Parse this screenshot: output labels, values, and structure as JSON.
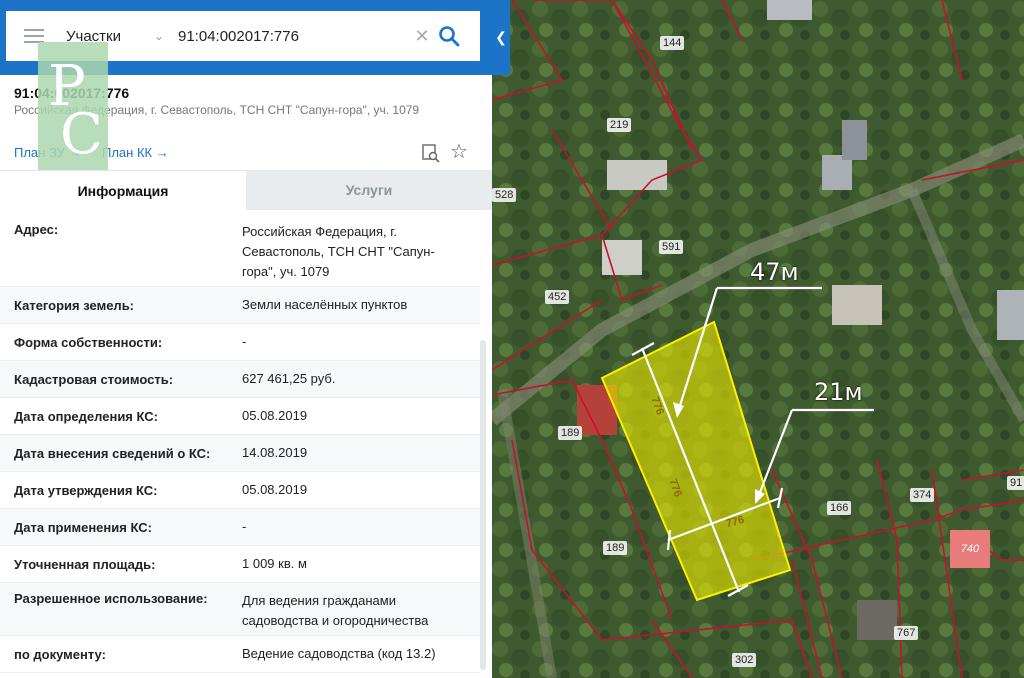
{
  "search": {
    "layer": "Участки",
    "value": "91:04:002017:776"
  },
  "object": {
    "cadastral_number": "91:04:002017:776",
    "address_short": "Российская Федерация, г. Севастополь, ТСН СНТ \"Сапун-гора\", уч. 1079",
    "plan_zu": "План ЗУ →",
    "plan_kk": "План КК →"
  },
  "tabs": {
    "info": "Информация",
    "services": "Услуги"
  },
  "rows": [
    {
      "key": "Адрес:",
      "value": "Российская Федерация, г. Севастополь, ТСН СНТ \"Сапун-гора\", уч. 1079"
    },
    {
      "key": "Категория земель:",
      "value": "Земли населённых пунктов"
    },
    {
      "key": "Форма собственности:",
      "value": "-"
    },
    {
      "key": "Кадастровая стоимость:",
      "value": "627 461,25 руб."
    },
    {
      "key": "Дата определения КС:",
      "value": "05.08.2019"
    },
    {
      "key": "Дата внесения сведений о КС:",
      "value": "14.08.2019"
    },
    {
      "key": "Дата утверждения КС:",
      "value": "05.08.2019"
    },
    {
      "key": "Дата применения КС:",
      "value": "-"
    },
    {
      "key": "Уточненная площадь:",
      "value": "1 009 кв. м"
    },
    {
      "key": "Разрешенное использование:",
      "value": "Для ведения гражданами садоводства и огородничества"
    },
    {
      "key": "по документу:",
      "value": "Ведение садоводства (код 13.2)"
    }
  ],
  "map": {
    "parcel_labels": [
      "144",
      "219",
      "528",
      "591",
      "452",
      "189",
      "189",
      "166",
      "374",
      "740",
      "767",
      "302",
      "91"
    ],
    "selected_parcel_labels": [
      "776",
      "776",
      "776"
    ],
    "measure_length": "47м",
    "measure_width": "21м",
    "colors": {
      "parcel_outline": "#c8102e",
      "selected_fill": "#e6e600",
      "accent": "#1b74c7"
    }
  },
  "icons": {
    "menu": "menu-icon",
    "dropdown": "chevron-down-icon",
    "clear": "close-icon",
    "search": "search-icon",
    "locate": "locate-icon",
    "favorite": "star-icon",
    "collapse": "chevron-left-icon"
  }
}
